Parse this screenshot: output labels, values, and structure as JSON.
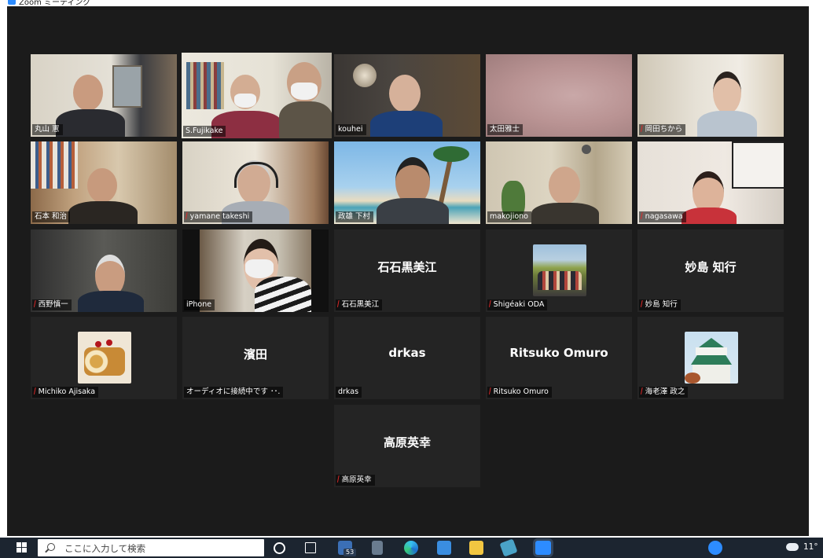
{
  "window": {
    "title": "Zoom ミーティング"
  },
  "participants": [
    {
      "name": "丸山 憲",
      "muted": false
    },
    {
      "name": "S.Fujikake",
      "muted": false,
      "speaking": true
    },
    {
      "name": "kouhei",
      "muted": false
    },
    {
      "name": "太田雅士",
      "muted": false
    },
    {
      "name": "岡田ちから",
      "muted": true
    },
    {
      "name": "石本 和治",
      "muted": false
    },
    {
      "name": "yamane takeshi",
      "muted": true
    },
    {
      "name": "政雄 下村",
      "muted": false
    },
    {
      "name": "makojiono",
      "muted": false
    },
    {
      "name": "nagasawa",
      "muted": true
    },
    {
      "name": "西野慎一",
      "muted": true
    },
    {
      "name": "iPhone",
      "muted": false
    },
    {
      "name": "石石黒美江",
      "display": "石石黒美江",
      "muted": true
    },
    {
      "name": "Shigéaki ODA",
      "muted": true,
      "avatar": "photo-group"
    },
    {
      "name": "妙島 知行",
      "display": "妙島 知行",
      "muted": true
    },
    {
      "name": "Michiko Ajisaka",
      "muted": true,
      "avatar": "cake"
    },
    {
      "name": "オーディオに接続中です ･･.",
      "display": "濱田",
      "muted": false
    },
    {
      "name": "drkas",
      "display": "drkas",
      "muted": false
    },
    {
      "name": "Ritsuko Omuro",
      "display": "Ritsuko Omuro",
      "muted": true
    },
    {
      "name": "海老澤 政之",
      "muted": true,
      "avatar": "castle"
    },
    {
      "name": "高原英幸",
      "display": "高原英幸",
      "muted": true
    }
  ],
  "taskbar": {
    "search_placeholder": "ここに入力して検索",
    "mail_badge": "53",
    "temperature": "11°",
    "pinned_icons": [
      "task-view-icon",
      "mail-icon",
      "calculator-icon",
      "edge-icon",
      "store-icon",
      "file-explorer-icon",
      "photos-icon",
      "zoom-icon"
    ]
  },
  "colors": {
    "meeting_bg": "#1b1b1b",
    "tile_bg": "#242424",
    "speaker_border": "#b6dc2b",
    "muted_icon": "#e02828",
    "taskbar": "#1c2530"
  }
}
